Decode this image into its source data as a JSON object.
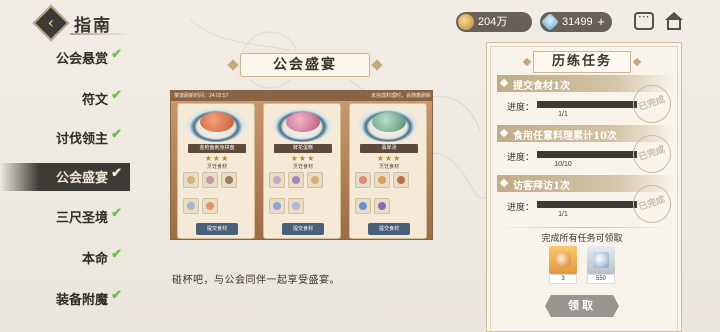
{
  "header": {
    "title": "指南",
    "currency_coin": "204万",
    "currency_gem": "31499"
  },
  "sidebar": {
    "items": [
      {
        "label": "公会悬赏",
        "done": true
      },
      {
        "label": "符文",
        "done": true
      },
      {
        "label": "讨伐领主",
        "done": true
      },
      {
        "label": "公会盛宴",
        "done": true,
        "active": true
      },
      {
        "label": "三尺圣境",
        "done": true
      },
      {
        "label": "本命",
        "done": true
      },
      {
        "label": "装备附魔",
        "done": true
      }
    ]
  },
  "main": {
    "banner": "公会盛宴",
    "description": "碰杯吧，与公会同伴一起享受盛宴。",
    "feast": {
      "top_left": "菜谱刷新时间：24:02:57",
      "top_right": "未完成料理时，会随着刷新",
      "cards": [
        {
          "dish_name": "金枪鱼刺身拼盘",
          "stars": "★★★",
          "sub_label": "烹饪食材",
          "button": "提交食材"
        },
        {
          "dish_name": "鲜花蛋糕",
          "stars": "★★★",
          "sub_label": "烹饪食材",
          "button": "提交食材"
        },
        {
          "dish_name": "翡翠汤",
          "stars": "★★★",
          "sub_label": "烹饪食材",
          "button": "提交食材"
        }
      ]
    }
  },
  "tasks_panel": {
    "title": "历练任务",
    "progress_label": "进度：",
    "stamp_text": "已完成",
    "tasks": [
      {
        "title": "提交食材1次",
        "progress": "1/1",
        "fraction": 1.0
      },
      {
        "title": "食用任意料理累计10次",
        "progress": "10/10",
        "fraction": 1.0
      },
      {
        "title": "访客拜访1次",
        "progress": "1/1",
        "fraction": 1.0
      }
    ],
    "all_complete_label": "完成所有任务可领取",
    "rewards": [
      {
        "icon": "gold-badge-icon",
        "qty": "3"
      },
      {
        "icon": "silver-gem-icon",
        "qty": "550"
      }
    ],
    "claim_button": "领取"
  },
  "colors": {
    "dark": "#3e3a36",
    "check_green": "#6bc24a",
    "accent_gold": "#c3a97f"
  }
}
